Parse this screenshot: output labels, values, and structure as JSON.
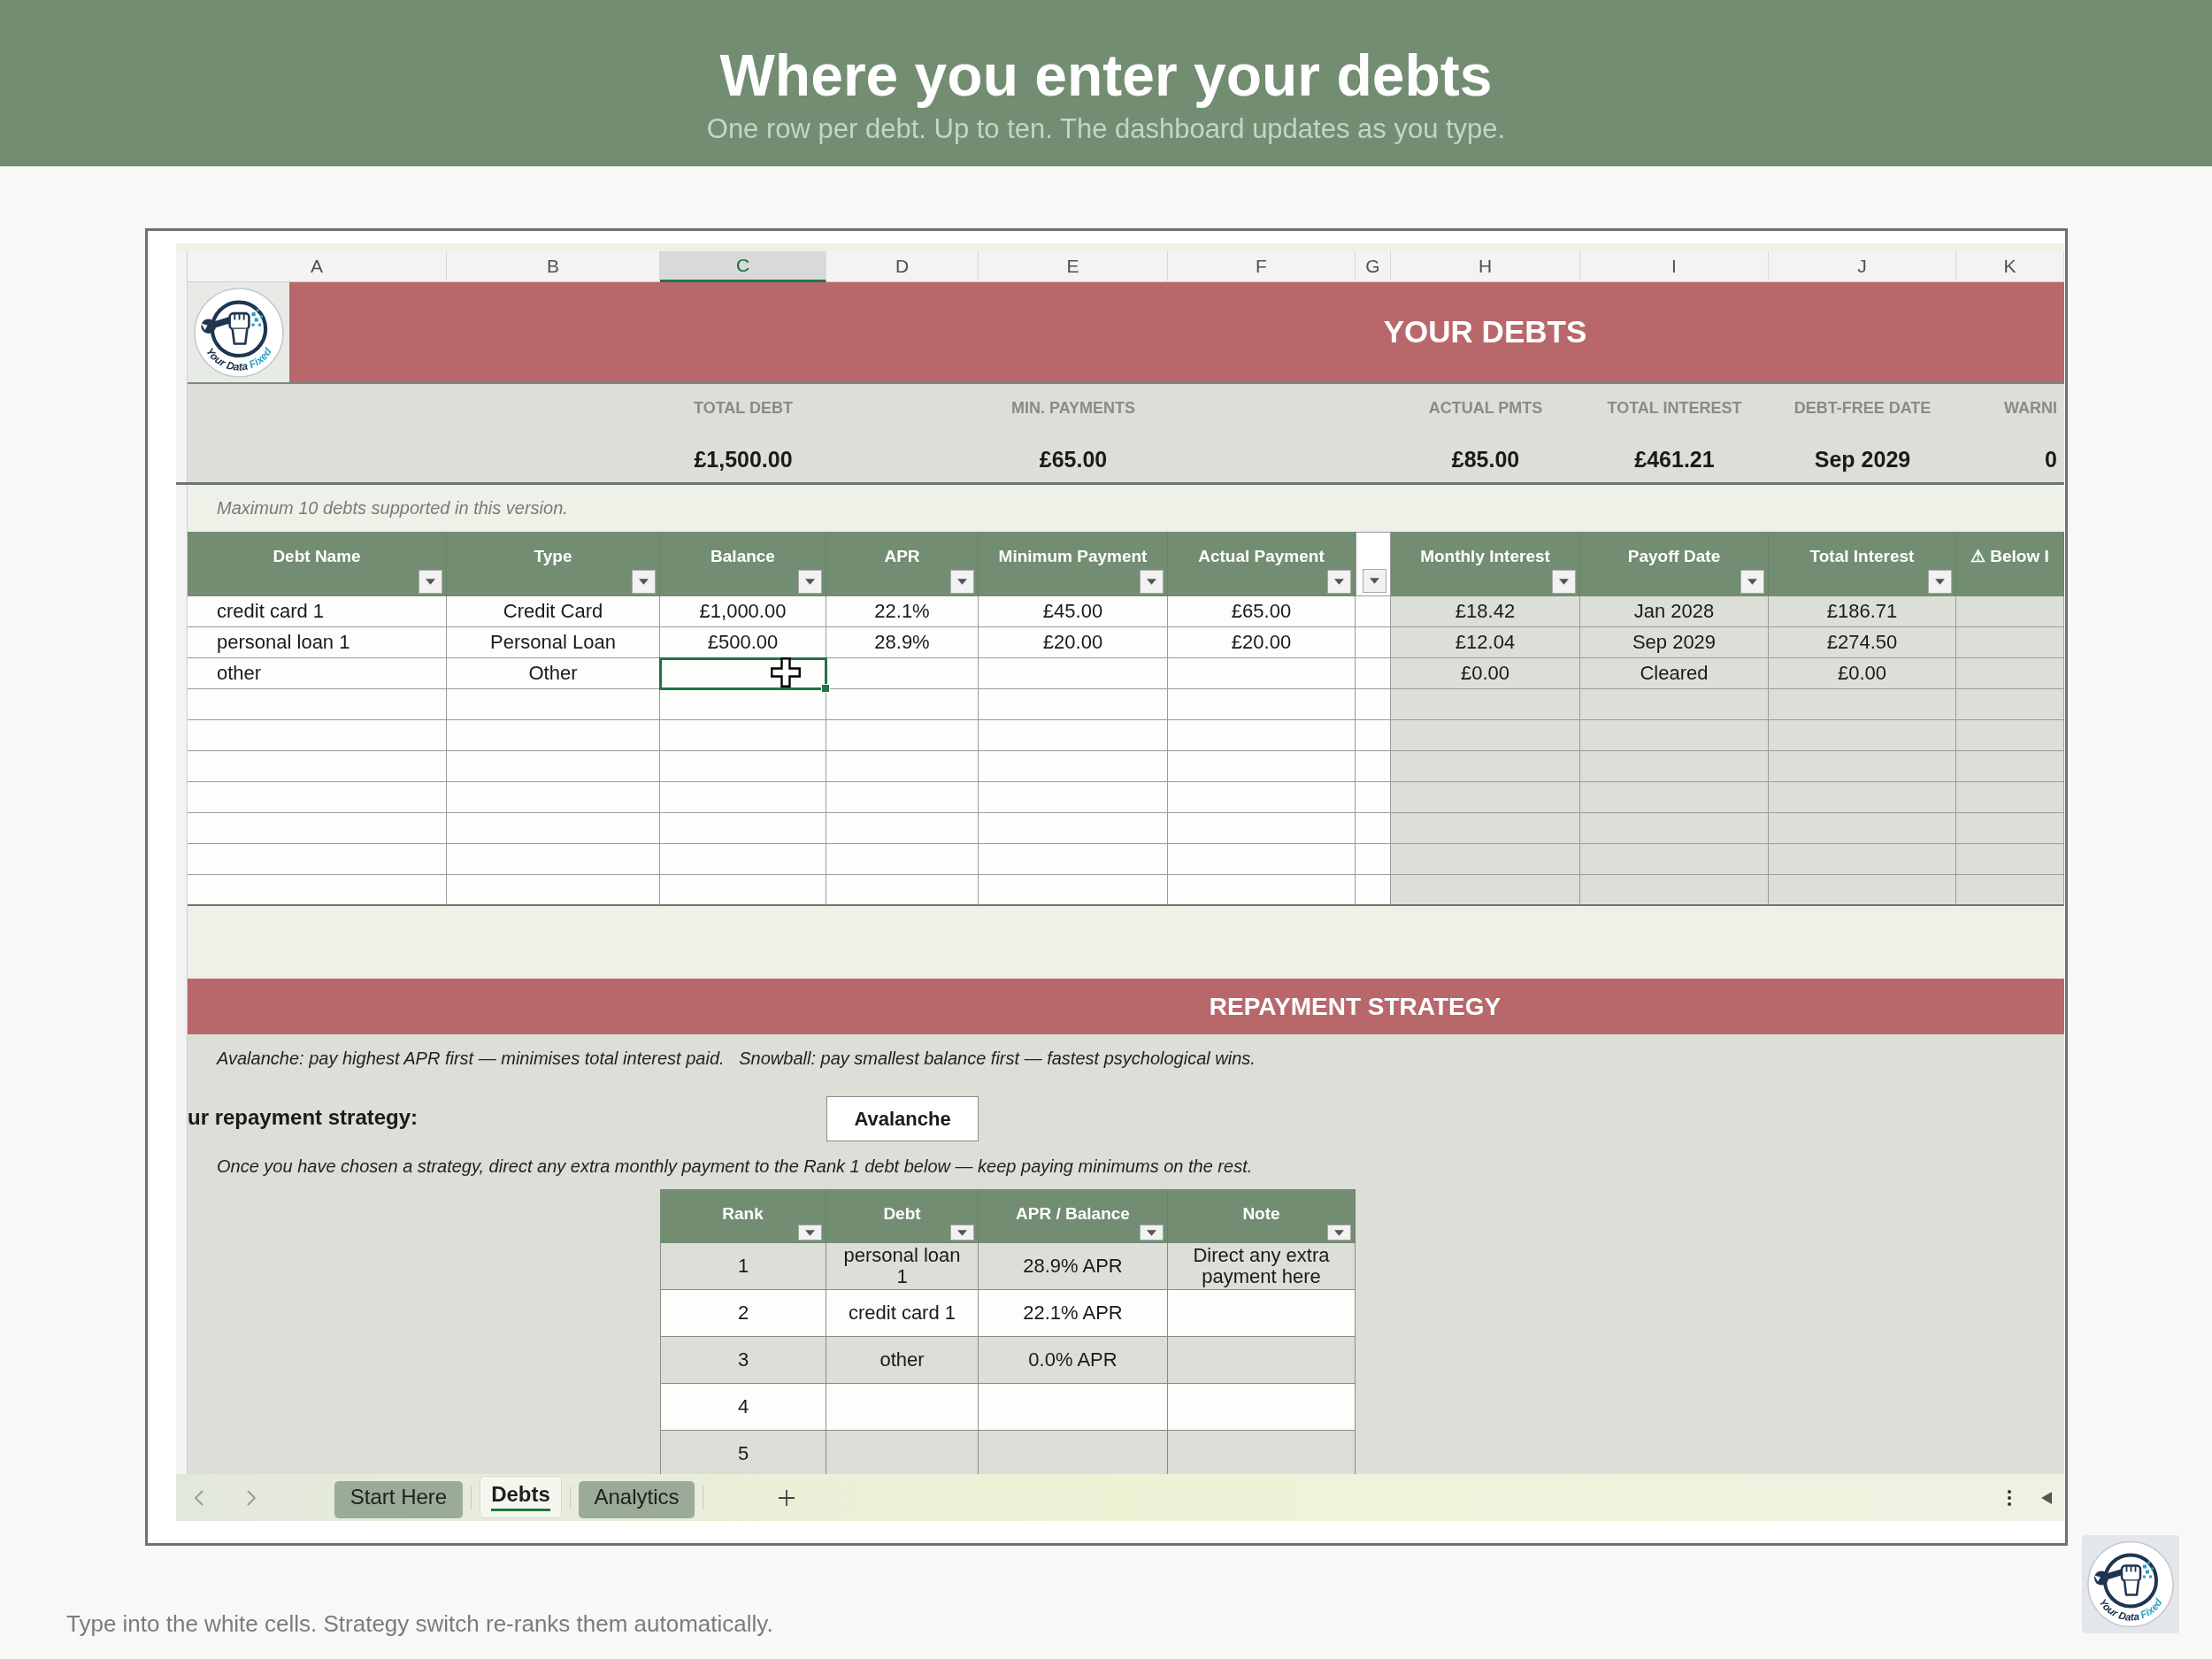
{
  "header": {
    "title": "Where you enter your debts",
    "subtitle": "One row per debt. Up to ten. The dashboard updates as you type."
  },
  "sheet": {
    "column_letters": [
      {
        "label": "A",
        "selected": false
      },
      {
        "label": "B",
        "selected": false
      },
      {
        "label": "C",
        "selected": true
      },
      {
        "label": "D",
        "selected": false
      },
      {
        "label": "E",
        "selected": false
      },
      {
        "label": "F",
        "selected": false
      },
      {
        "label": "G",
        "selected": false
      },
      {
        "label": "H",
        "selected": false
      },
      {
        "label": "I",
        "selected": false
      },
      {
        "label": "J",
        "selected": false
      },
      {
        "label": "K",
        "selected": false
      }
    ],
    "logo": {
      "text": "Your Data Fixed"
    },
    "title": "YOUR DEBTS",
    "summary": [
      {
        "label": "TOTAL DEBT",
        "value": "£1,500.00"
      },
      {
        "label": "MIN. PAYMENTS",
        "value": "£65.00"
      },
      {
        "label": "ACTUAL PMTS",
        "value": "£85.00"
      },
      {
        "label": "TOTAL INTEREST",
        "value": "£461.21"
      },
      {
        "label": "DEBT-FREE DATE",
        "value": "Sep 2029"
      },
      {
        "label": "WARNI",
        "value": "0"
      }
    ],
    "note": "Maximum 10 debts supported in this version.",
    "debts_table": {
      "columns": [
        {
          "label": "Debt Name",
          "filter": true
        },
        {
          "label": "Type",
          "filter": true
        },
        {
          "label": "Balance",
          "filter": true
        },
        {
          "label": "APR",
          "filter": true
        },
        {
          "label": "Minimum Payment",
          "filter": true
        },
        {
          "label": "Actual Payment",
          "filter": true
        },
        {
          "filter": true
        },
        {
          "label": "Monthly Interest",
          "filter": true
        },
        {
          "label": "Payoff Date",
          "filter": true
        },
        {
          "label": "Total Interest",
          "filter": true
        },
        {
          "label": "⚠ Below I",
          "filter": false
        }
      ],
      "rows": [
        {
          "debt_name": "credit card 1",
          "type": "Credit Card",
          "balance": "£1,000.00",
          "apr": "22.1%",
          "minimum_payment": "£45.00",
          "actual_payment": "£65.00",
          "monthly_interest": "£18.42",
          "payoff_date": "Jan 2028",
          "total_interest": "£186.71",
          "has_active_cell": false
        },
        {
          "debt_name": "personal loan 1",
          "type": "Personal Loan",
          "balance": "£500.00",
          "apr": "28.9%",
          "minimum_payment": "£20.00",
          "actual_payment": "£20.00",
          "monthly_interest": "£12.04",
          "payoff_date": "Sep 2029",
          "total_interest": "£274.50",
          "has_active_cell": false
        },
        {
          "debt_name": "other",
          "type": "Other",
          "monthly_interest": "£0.00",
          "payoff_date": "Cleared",
          "total_interest": "£0.00",
          "has_active_cell": true
        }
      ]
    },
    "strategy": {
      "title": "REPAYMENT STRATEGY",
      "explanation": "Avalanche: pay highest APR first — minimises total interest paid.   Snowball: pay smallest balance first — fastest psychological wins.",
      "label": "ur repayment strategy:",
      "value": "Avalanche",
      "instruction": "Once you have chosen a strategy, direct any extra monthly payment to the Rank 1 debt below — keep paying minimums on the rest.",
      "rank_table": {
        "columns": [
          {
            "label": "Rank",
            "filter": true
          },
          {
            "label": "Debt",
            "filter": true
          },
          {
            "label": "APR / Balance",
            "filter": true
          },
          {
            "label": "Note",
            "filter": true
          }
        ],
        "rows": [
          {
            "rank": "1",
            "debt": "personal loan 1",
            "apr_balance": "28.9% APR",
            "note": "Direct any extra payment here"
          },
          {
            "rank": "2",
            "debt": "credit card 1",
            "apr_balance": "22.1% APR"
          },
          {
            "rank": "3",
            "debt": "other",
            "apr_balance": "0.0% APR"
          },
          {
            "rank": "4"
          },
          {
            "rank": "5"
          }
        ]
      }
    },
    "sheet_tabs": [
      {
        "label": "Start Here",
        "selected": false
      },
      {
        "label": "Debts",
        "selected": true
      },
      {
        "label": "Analytics",
        "selected": false
      }
    ]
  },
  "footer": {
    "text": "Type into the white cells. Strategy switch re-ranks them automatically.",
    "logo": {
      "text": "Your Data Fixed"
    }
  }
}
